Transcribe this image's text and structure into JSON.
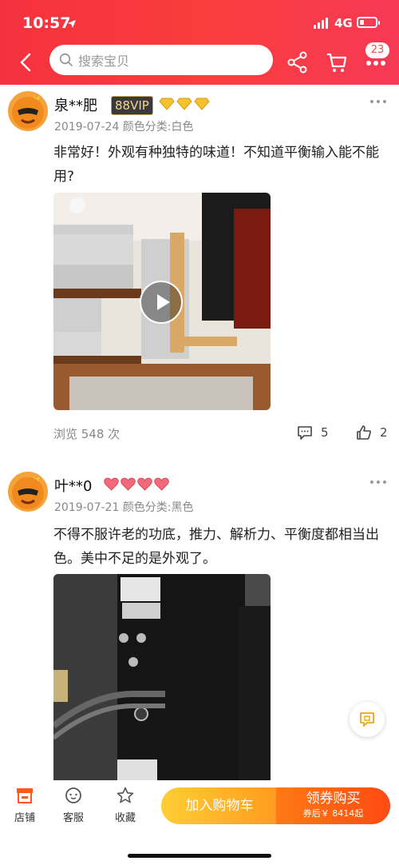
{
  "status_bar": {
    "time": "10:57",
    "network": "4G"
  },
  "header": {
    "search_placeholder": "搜索宝贝",
    "cart_badge": "23"
  },
  "reviews": [
    {
      "username": "泉**肥",
      "vip": "88VIP",
      "rank_icons": [
        "diamond-icon",
        "diamond-icon",
        "diamond-icon"
      ],
      "meta": "2019-07-24 颜色分类:白色",
      "content": "非常好！外观有种独特的味道！不知道平衡输入能不能用?",
      "views": "浏览 548 次",
      "comments": "5",
      "likes": "2"
    },
    {
      "username": "叶**0",
      "rank_icons": [
        "heart-icon",
        "heart-icon",
        "heart-icon",
        "heart-icon"
      ],
      "meta": "2019-07-21 颜色分类:黑色",
      "content": "不得不服许老的功底，推力、解析力、平衡度都相当出色。美中不足的是外观了。"
    }
  ],
  "bottom_bar": {
    "shop": "店铺",
    "service": "客服",
    "favorite": "收藏",
    "add_to_cart": "加入购物车",
    "buy_label": "领券购买",
    "buy_sub": "券后￥ 8414起"
  },
  "colors": {
    "header_red": "#f5313f",
    "cart_yellow": "#ffb62a",
    "buy_orange": "#ff5a14",
    "shop_icon": "#ff5a1e"
  }
}
